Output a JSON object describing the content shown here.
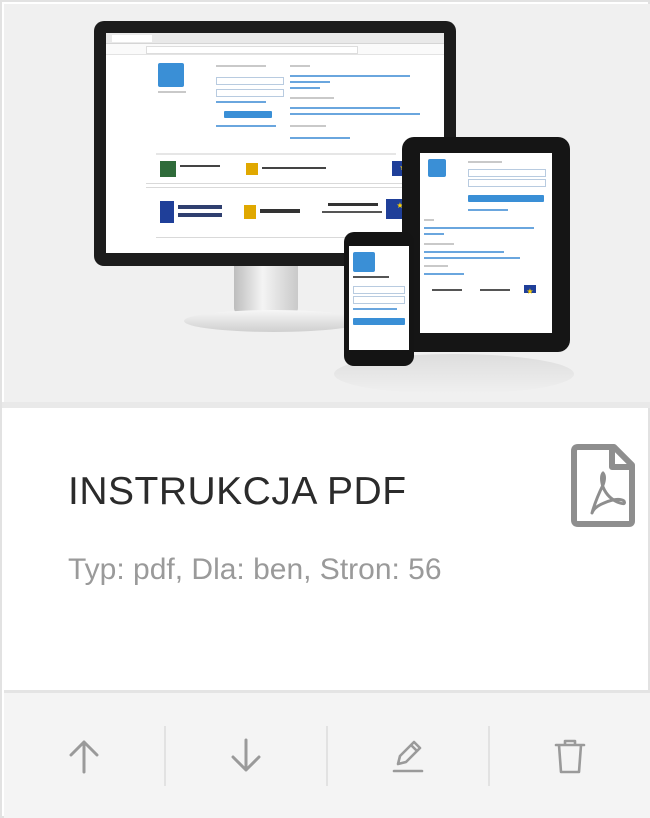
{
  "document": {
    "title": "INSTRUKCJA PDF",
    "meta": "Typ: pdf, Dla: ben, Stron: 56"
  },
  "icons": {
    "file_type": "pdf-file-icon",
    "actions": [
      "arrow-up-icon",
      "arrow-down-icon",
      "pencil-icon",
      "trash-icon"
    ]
  },
  "colors": {
    "title": "#2b2b2b",
    "meta": "#9a9a9a",
    "icon": "#9a9a9a",
    "pdf_icon": "#8e8e8e",
    "accent": "#3a8fd6"
  }
}
